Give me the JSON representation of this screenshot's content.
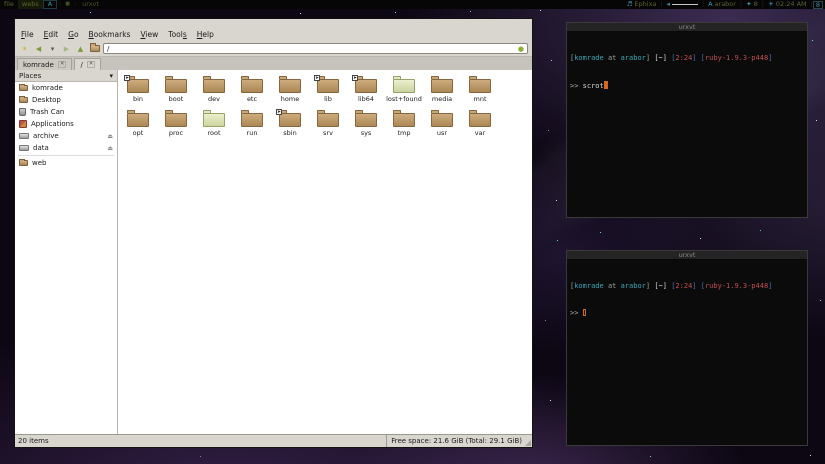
{
  "topbar": {
    "tags": [
      {
        "label": "file",
        "style": "plain"
      },
      {
        "label": "webs",
        "style": "selected"
      },
      {
        "label": "A",
        "style": "accent"
      }
    ],
    "layout_indicator": {
      "dot": "·",
      "square": "■"
    },
    "focused_window_title": "urxvt",
    "separator": "|",
    "status": [
      {
        "name": "music",
        "icon": "♬",
        "text": "Ephixa",
        "slider": false,
        "boxed": false
      },
      {
        "name": "volume",
        "icon": "◂",
        "text": "",
        "slider": true,
        "boxed": false
      },
      {
        "name": "user",
        "icon": "A",
        "text": "arabor",
        "slider": false,
        "boxed": false
      },
      {
        "name": "indicator",
        "icon": "✦",
        "text": "8",
        "slider": false,
        "boxed": false
      },
      {
        "name": "clock",
        "icon": "☀",
        "text": "02:24 AM",
        "slider": false,
        "boxed": false
      },
      {
        "name": "tray",
        "icon": "",
        "text": "8",
        "slider": false,
        "boxed": true
      }
    ]
  },
  "filemanager": {
    "menus": [
      {
        "label": "File",
        "u": 0
      },
      {
        "label": "Edit",
        "u": 0
      },
      {
        "label": "Go",
        "u": 0
      },
      {
        "label": "Bookmarks",
        "u": 0
      },
      {
        "label": "View",
        "u": 0
      },
      {
        "label": "Tools",
        "u": 4
      },
      {
        "label": "Help",
        "u": 0
      }
    ],
    "toolbar": {
      "buttons": [
        {
          "name": "new-tab",
          "glyph": "✶",
          "color": "#c9b832"
        },
        {
          "name": "back",
          "glyph": "◀",
          "color": "#7d9a3d"
        },
        {
          "name": "history-dropdown",
          "glyph": "▾",
          "color": "#55584e"
        },
        {
          "name": "forward",
          "glyph": "▶",
          "color": "#a9b78c"
        },
        {
          "name": "up",
          "glyph": "▲",
          "color": "#7d9a3d"
        },
        {
          "name": "open-folder",
          "glyph": "folder",
          "color": "#b5905f"
        }
      ],
      "path_value": "/",
      "go_button_glyph": "●",
      "go_button_color": "#8fae3a"
    },
    "tabs": [
      {
        "label": "komrade",
        "active": false
      },
      {
        "label": "/",
        "active": true
      }
    ],
    "tab_close_glyph": "✕",
    "sidebar": {
      "header": "Places",
      "header_dropdown_glyph": "▾",
      "eject_glyph": "⏏",
      "items": [
        {
          "label": "komrade",
          "icon": "folder",
          "eject": false,
          "separator_before": false
        },
        {
          "label": "Desktop",
          "icon": "folder",
          "eject": false,
          "separator_before": false
        },
        {
          "label": "Trash Can",
          "icon": "trash",
          "eject": false,
          "separator_before": false
        },
        {
          "label": "Applications",
          "icon": "apps",
          "eject": false,
          "separator_before": false
        },
        {
          "label": "archive",
          "icon": "drive",
          "eject": true,
          "separator_before": false
        },
        {
          "label": "data",
          "icon": "drive",
          "eject": true,
          "separator_before": false
        },
        {
          "label": "web",
          "icon": "folder",
          "eject": false,
          "separator_before": true
        }
      ]
    },
    "symlink_glyph": "➤",
    "folders": [
      {
        "name": "bin",
        "symlink": true,
        "pale": false
      },
      {
        "name": "boot",
        "symlink": false,
        "pale": false
      },
      {
        "name": "dev",
        "symlink": false,
        "pale": false
      },
      {
        "name": "etc",
        "symlink": false,
        "pale": false
      },
      {
        "name": "home",
        "symlink": false,
        "pale": false
      },
      {
        "name": "lib",
        "symlink": true,
        "pale": false
      },
      {
        "name": "lib64",
        "symlink": true,
        "pale": false
      },
      {
        "name": "lost+found",
        "symlink": false,
        "pale": true
      },
      {
        "name": "media",
        "symlink": false,
        "pale": false
      },
      {
        "name": "mnt",
        "symlink": false,
        "pale": false
      },
      {
        "name": "opt",
        "symlink": false,
        "pale": false
      },
      {
        "name": "proc",
        "symlink": false,
        "pale": false
      },
      {
        "name": "root",
        "symlink": false,
        "pale": true
      },
      {
        "name": "run",
        "symlink": false,
        "pale": false
      },
      {
        "name": "sbin",
        "symlink": true,
        "pale": false
      },
      {
        "name": "srv",
        "symlink": false,
        "pale": false
      },
      {
        "name": "sys",
        "symlink": false,
        "pale": false
      },
      {
        "name": "tmp",
        "symlink": false,
        "pale": false
      },
      {
        "name": "usr",
        "symlink": false,
        "pale": false
      },
      {
        "name": "var",
        "symlink": false,
        "pale": false
      }
    ],
    "status_left": "20 items",
    "status_right": "Free space: 21.6 GiB (Total: 29.1 GiB)"
  },
  "terminal_prompt": {
    "segments": [
      {
        "text": "[",
        "color": "prompt_gray"
      },
      {
        "text": "komrade",
        "color": "accent_cyan"
      },
      {
        "text": " at ",
        "color": "prompt_gray"
      },
      {
        "text": "arabor",
        "color": "accent_cyan"
      },
      {
        "text": "] ",
        "color": "prompt_gray"
      },
      {
        "text": "[~]",
        "color": "prompt_white"
      },
      {
        "text": " ",
        "color": "prompt_gray"
      },
      {
        "text": "[",
        "color": "prompt_blue"
      },
      {
        "text": "2:24",
        "color": "prompt_red"
      },
      {
        "text": "]",
        "color": "prompt_blue"
      },
      {
        "text": " ",
        "color": "prompt_gray"
      },
      {
        "text": "[",
        "color": "prompt_blue"
      },
      {
        "text": "ruby-1.9.3-p448",
        "color": "prompt_red"
      },
      {
        "text": "]",
        "color": "prompt_blue"
      }
    ],
    "ps": ">>"
  },
  "terminals": [
    {
      "title": "urxvt",
      "command": "scrot",
      "cursor": "block"
    },
    {
      "title": "urxvt",
      "command": "",
      "cursor": "outline"
    }
  ],
  "colors": {
    "accent_cyan": "#3aa7b8",
    "prompt_gray": "#9e9e9e",
    "prompt_white": "#d8d8d8",
    "prompt_blue": "#4a6fb5",
    "prompt_red": "#c05050",
    "prompt_ps": "#b0b0b0",
    "cursor_orange": "#d2691e",
    "bar_olive": "#5a6430",
    "bar_teal": "#3d96a8"
  }
}
